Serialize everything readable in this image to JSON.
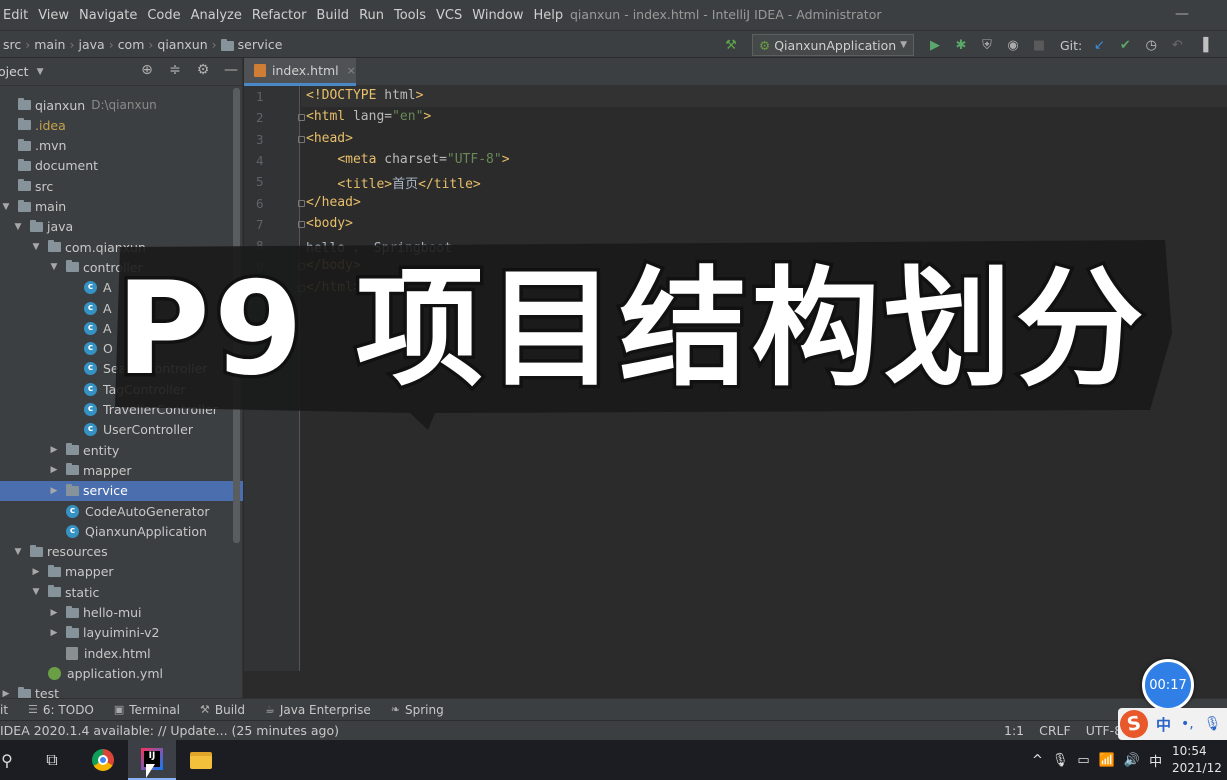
{
  "menubar": {
    "items": [
      "Edit",
      "View",
      "Navigate",
      "Code",
      "Analyze",
      "Refactor",
      "Build",
      "Run",
      "Tools",
      "VCS",
      "Window",
      "Help"
    ],
    "window_title": "qianxun - index.html - IntelliJ IDEA - Administrator",
    "minimize": "—"
  },
  "breadcrumb": [
    "src",
    "main",
    "java",
    "com",
    "qianxun",
    "service"
  ],
  "toolbar": {
    "build_icon": "hammer-icon",
    "run_config": "QianxunApplication",
    "git_label": "Git:",
    "run": "▶",
    "debug": "✱",
    "coverage": "⛨",
    "profile": "◉",
    "stop": "■",
    "git_update": "↙",
    "git_commit": "✔",
    "history": "◷",
    "rollback": "↶"
  },
  "project_panel": {
    "header_label": "oject",
    "tree": [
      {
        "label": "qianxun",
        "extra": "D:\\qianxun",
        "indent": 0,
        "icon": "folder",
        "arrow": ""
      },
      {
        "label": ".idea",
        "indent": 0,
        "icon": "folder",
        "arrow": "",
        "style": "idea"
      },
      {
        "label": ".mvn",
        "indent": 0,
        "icon": "folder",
        "arrow": ""
      },
      {
        "label": "document",
        "indent": 0,
        "icon": "folder",
        "arrow": ""
      },
      {
        "label": "src",
        "indent": 0,
        "icon": "folder",
        "arrow": ""
      },
      {
        "label": "main",
        "indent": 0,
        "icon": "folder",
        "arrow": "▼"
      },
      {
        "label": "java",
        "indent": 1,
        "icon": "folder",
        "arrow": "▼"
      },
      {
        "label": "com.qianxun",
        "indent": 2,
        "icon": "folder",
        "arrow": "▼"
      },
      {
        "label": "controller",
        "indent": 3,
        "icon": "folder",
        "arrow": "▼"
      },
      {
        "label": "A",
        "indent": 4,
        "icon": "class",
        "arrow": ""
      },
      {
        "label": "A",
        "indent": 4,
        "icon": "class",
        "arrow": ""
      },
      {
        "label": "A",
        "indent": 4,
        "icon": "class",
        "arrow": ""
      },
      {
        "label": "O",
        "indent": 4,
        "icon": "class",
        "arrow": ""
      },
      {
        "label": "SearchController",
        "indent": 4,
        "icon": "class",
        "arrow": ""
      },
      {
        "label": "TagController",
        "indent": 4,
        "icon": "class",
        "arrow": ""
      },
      {
        "label": "TravellerController",
        "indent": 4,
        "icon": "class",
        "arrow": ""
      },
      {
        "label": "UserController",
        "indent": 4,
        "icon": "class",
        "arrow": ""
      },
      {
        "label": "entity",
        "indent": 3,
        "icon": "folder",
        "arrow": "▶"
      },
      {
        "label": "mapper",
        "indent": 3,
        "icon": "folder",
        "arrow": "▶"
      },
      {
        "label": "service",
        "indent": 3,
        "icon": "folder",
        "arrow": "▶",
        "selected": true
      },
      {
        "label": "CodeAutoGenerator",
        "indent": 3,
        "icon": "class",
        "arrow": ""
      },
      {
        "label": "QianxunApplication",
        "indent": 3,
        "icon": "class",
        "arrow": ""
      },
      {
        "label": "resources",
        "indent": 1,
        "icon": "folder",
        "arrow": "▼"
      },
      {
        "label": "mapper",
        "indent": 2,
        "icon": "folder",
        "arrow": "▶"
      },
      {
        "label": "static",
        "indent": 2,
        "icon": "folder",
        "arrow": "▼"
      },
      {
        "label": "hello-mui",
        "indent": 3,
        "icon": "folder",
        "arrow": "▶"
      },
      {
        "label": "layuimini-v2",
        "indent": 3,
        "icon": "folder",
        "arrow": "▶"
      },
      {
        "label": "index.html",
        "indent": 3,
        "icon": "html",
        "arrow": ""
      },
      {
        "label": "application.yml",
        "indent": 2,
        "icon": "yml",
        "arrow": ""
      },
      {
        "label": "test",
        "indent": 0,
        "icon": "folder",
        "arrow": "▶"
      }
    ]
  },
  "editor": {
    "tab_label": "index.html",
    "tab_close": "×",
    "lines": [
      {
        "n": "1",
        "tokens": [
          [
            "tag",
            "<!DOCTYPE "
          ],
          [
            "attr",
            "html"
          ],
          [
            "tag",
            ">"
          ]
        ]
      },
      {
        "n": "2",
        "tokens": [
          [
            "tag",
            "<html "
          ],
          [
            "attr",
            "lang="
          ],
          [
            "str",
            "\"en\""
          ],
          [
            "tag",
            ">"
          ]
        ]
      },
      {
        "n": "3",
        "tokens": [
          [
            "tag",
            "<head>"
          ]
        ]
      },
      {
        "n": "4",
        "tokens": [
          [
            "plain",
            "    "
          ],
          [
            "tag",
            "<meta "
          ],
          [
            "attr",
            "charset="
          ],
          [
            "str",
            "\"UTF-8\""
          ],
          [
            "tag",
            ">"
          ]
        ]
      },
      {
        "n": "5",
        "tokens": [
          [
            "plain",
            "    "
          ],
          [
            "tag",
            "<title>"
          ],
          [
            "plain",
            "首页"
          ],
          [
            "tag",
            "</title>"
          ]
        ]
      },
      {
        "n": "6",
        "tokens": [
          [
            "tag",
            "</head>"
          ]
        ]
      },
      {
        "n": "7",
        "tokens": [
          [
            "tag",
            "<body>"
          ]
        ]
      },
      {
        "n": "8",
        "tokens": [
          [
            "plain",
            "hello ， Springboot"
          ]
        ]
      },
      {
        "n": "9",
        "tokens": [
          [
            "tag",
            "</body>"
          ]
        ]
      },
      {
        "n": "10",
        "tokens": [
          [
            "tag",
            "</html>"
          ]
        ]
      }
    ]
  },
  "overlay_title": "P9 项目结构划分",
  "tool_windows": [
    {
      "icon": "",
      "label": "it"
    },
    {
      "icon": "☰",
      "label": "6: TODO"
    },
    {
      "icon": "▣",
      "label": "Terminal"
    },
    {
      "icon": "⚒",
      "label": "Build"
    },
    {
      "icon": "☕",
      "label": "Java Enterprise"
    },
    {
      "icon": "❧",
      "label": "Spring"
    }
  ],
  "status": {
    "message": "IDEA 2020.1.4 available: // Update... (25 minutes ago)",
    "position": "1:1",
    "line_sep": "CRLF",
    "encoding": "UTF-8"
  },
  "timer": "00:17",
  "ime": {
    "logo": "S",
    "lang": "中",
    "punct": "•,",
    "mic": "🎙"
  },
  "taskbar": {
    "search_icon": "⚲",
    "taskview_icon": "⧉",
    "idea_icon_text": "IJ",
    "tray": [
      "^",
      "🎙",
      "▭",
      "📶",
      "🔊",
      "中"
    ],
    "time": "10:54",
    "date": "2021/12"
  }
}
